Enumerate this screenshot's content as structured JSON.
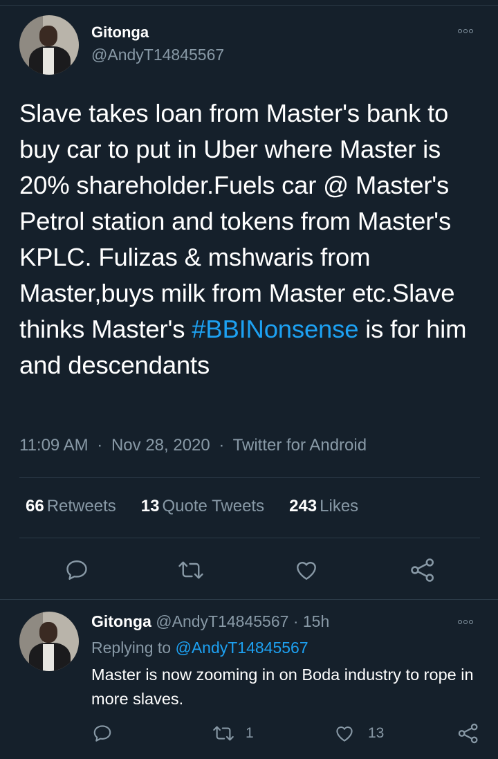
{
  "main_tweet": {
    "author_name": "Gitonga",
    "author_handle": "@AndyT14845567",
    "text_before_hashtag": "Slave takes loan from Master's bank to buy car to put in Uber where Master is 20% shareholder.Fuels car @ Master's Petrol station and tokens from Master's KPLC. Fulizas & mshwaris from Master,buys milk from Master etc.Slave thinks Master's ",
    "hashtag": "#BBINonsense",
    "text_after_hashtag": " is for him and descendants",
    "time": "11:09 AM",
    "date": "Nov 28, 2020",
    "source": "Twitter for Android",
    "separator": "·",
    "stats": {
      "retweets_count": "66",
      "retweets_label": "Retweets",
      "quotes_count": "13",
      "quotes_label": "Quote Tweets",
      "likes_count": "243",
      "likes_label": "Likes"
    },
    "actions": [
      "reply-icon",
      "retweet-icon",
      "like-icon",
      "share-icon"
    ]
  },
  "reply_tweet": {
    "author_name": "Gitonga",
    "author_handle": "@AndyT14845567",
    "separator": "·",
    "time_ago": "15h",
    "replying_label": "Replying to",
    "replying_to": "@AndyT14845567",
    "text": "Master is now zooming in on Boda industry to rope in more slaves.",
    "retweet_count": "1",
    "like_count": "13"
  },
  "colors": {
    "background": "#15202b",
    "accent": "#1da1f2",
    "secondary_text": "#8899a6",
    "divider": "#2c3b48"
  }
}
